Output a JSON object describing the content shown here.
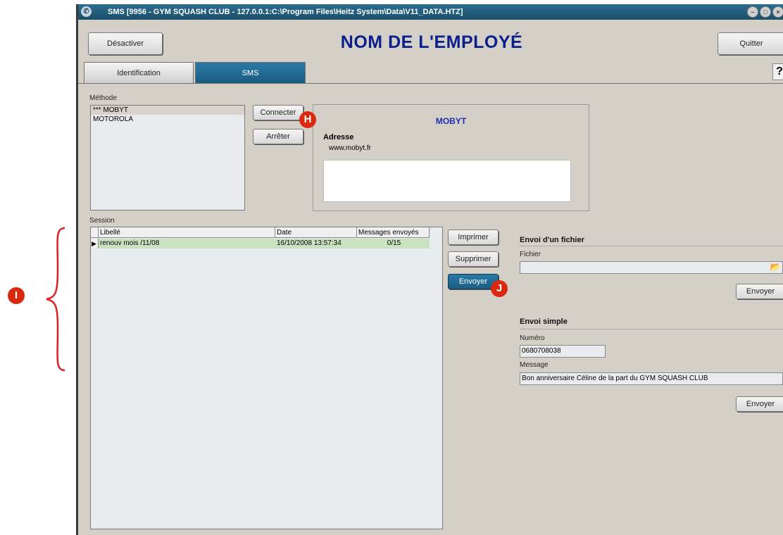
{
  "window": {
    "title": "SMS [9956 - GYM SQUASH CLUB - 127.0.0.1:C:\\Program Files\\Heitz System\\Data\\V11_DATA.HTZ]",
    "controls": [
      "minimize-icon",
      "maximize-icon",
      "close-icon"
    ]
  },
  "header": {
    "title": "NOM DE L'EMPLOYÉ",
    "deactivate_label": "Désactiver",
    "quit_label": "Quitter",
    "help_label": "?"
  },
  "tabs": [
    {
      "label": "Identification",
      "active": false
    },
    {
      "label": "SMS",
      "active": true
    }
  ],
  "methode": {
    "label": "Méthode",
    "items": [
      {
        "label": "*** MOBYT",
        "selected": true
      },
      {
        "label": "MOTOROLA",
        "selected": false
      }
    ],
    "connect_label": "Connecter",
    "stop_label": "Arrêter"
  },
  "provider": {
    "name": "MOBYT",
    "address_label": "Adresse",
    "address_value": "www.mobyt.fr",
    "notes": ""
  },
  "session": {
    "label": "Session",
    "columns": [
      "Libellé",
      "Date",
      "Messages envoyés"
    ],
    "rows": [
      {
        "libelle": "renouv mois /11/08",
        "date": "16/10/2008 13:57:34",
        "messages": "0/15"
      }
    ],
    "print_label": "Imprimer",
    "delete_label": "Supprimer",
    "send_label": "Envoyer"
  },
  "file_send": {
    "title": "Envoi d'un fichier",
    "file_label": "Fichier",
    "file_value": "",
    "send_label": "Envoyer"
  },
  "simple_send": {
    "title": "Envoi simple",
    "number_label": "Numéro",
    "number_value": "0680708038",
    "message_label": "Message",
    "message_value": "Bon anniversaire Céline de la part du GYM SQUASH CLUB",
    "send_label": "Envoyer"
  },
  "annotations": {
    "h": "H",
    "i": "I",
    "j": "J",
    "color": "#d92a10",
    "bracket_color": "#e02020"
  }
}
